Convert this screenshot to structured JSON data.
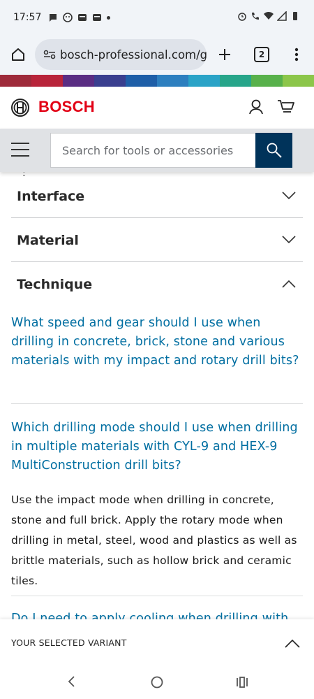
{
  "status_bar": {
    "time": "17:57"
  },
  "browser": {
    "url": "bosch-professional.com/gb",
    "tab_count": "2"
  },
  "supergraphic_colors": [
    "#9e2a3a",
    "#b8243a",
    "#5a2d83",
    "#3a3f8f",
    "#1f5fa8",
    "#2d7fbf",
    "#2aa3c7",
    "#27a58a",
    "#58b14b",
    "#8cc64a"
  ],
  "site": {
    "brand": "BOSCH",
    "brand_color": "#e20015",
    "search_placeholder": "Search for tools or accessories",
    "search_button_color": "#00335a"
  },
  "accordion": [
    {
      "title": "Interface",
      "expanded": false
    },
    {
      "title": "Material",
      "expanded": false
    },
    {
      "title": "Technique",
      "expanded": true
    }
  ],
  "faq": {
    "q1": "What speed and gear should I use when drilling in concrete, brick, stone and various materials with my impact and rotary drill bits?",
    "q2": "Which drilling mode should I use when drilling in multiple materials with CYL-9 and HEX-9 MultiConstruction drill bits?",
    "a2": "Use the impact mode when drilling in concrete, stone and full brick. Apply the rotary mode when drilling in metal, steel, wood and plastics as well as brittle materials, such as hollow brick and ceramic tiles.",
    "q3": "Do I need to apply cooling when drilling with"
  },
  "variant_bar": {
    "label": "YOUR SELECTED VARIANT"
  },
  "colors": {
    "link": "#006ea1"
  }
}
